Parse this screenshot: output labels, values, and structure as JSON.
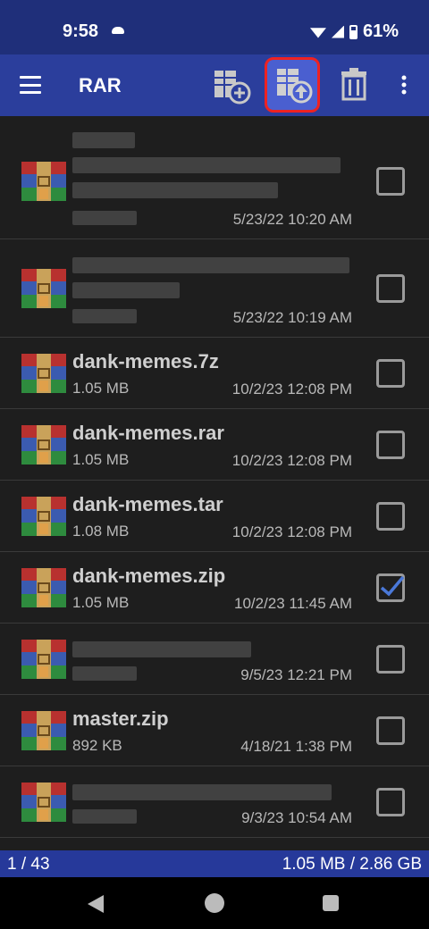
{
  "status": {
    "time": "9:58",
    "battery": "61%"
  },
  "toolbar": {
    "title": "RAR"
  },
  "files": [
    {
      "name": "",
      "size": "",
      "date": "5/23/22 10:20 AM",
      "checked": false,
      "blurred": true
    },
    {
      "name": "",
      "size": "",
      "date": "5/23/22 10:19 AM",
      "checked": false,
      "blurred": true
    },
    {
      "name": "dank-memes.7z",
      "size": "1.05 MB",
      "date": "10/2/23 12:08 PM",
      "checked": false
    },
    {
      "name": "dank-memes.rar",
      "size": "1.05 MB",
      "date": "10/2/23 12:08 PM",
      "checked": false
    },
    {
      "name": "dank-memes.tar",
      "size": "1.08 MB",
      "date": "10/2/23 12:08 PM",
      "checked": false
    },
    {
      "name": "dank-memes.zip",
      "size": "1.05 MB",
      "date": "10/2/23 11:45 AM",
      "checked": true
    },
    {
      "name": "",
      "size": "",
      "date": "9/5/23 12:21 PM",
      "checked": false,
      "blurred": true
    },
    {
      "name": "master.zip",
      "size": "892 KB",
      "date": "4/18/21 1:38 PM",
      "checked": false
    },
    {
      "name": "",
      "size": "",
      "date": "9/3/23 10:54 AM",
      "checked": false,
      "blurred": true
    }
  ],
  "footer": {
    "selection": "1 / 43",
    "size_summary": "1.05 MB / 2.86 GB"
  },
  "icons": {
    "menu": "hamburger-menu-icon",
    "add_archive": "add-to-archive-icon",
    "extract": "extract-archive-icon",
    "delete": "trash-icon",
    "more": "overflow-menu-icon"
  },
  "colors": {
    "toolbar": "#2b3e9c",
    "statusbar": "#1f2f7a",
    "highlight": "#e22222",
    "check": "#4a78d8"
  }
}
